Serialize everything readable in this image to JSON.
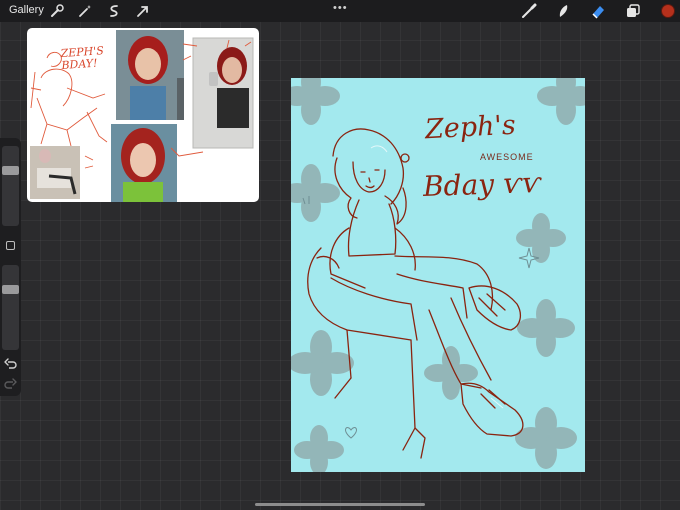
{
  "topbar": {
    "gallery_label": "Gallery",
    "more_label": "•••",
    "left_tools": [
      "wrench-icon",
      "magic-wand-icon",
      "selection-icon",
      "transform-arrow-icon"
    ],
    "right_tools": [
      "brush-icon",
      "smudge-icon",
      "eraser-icon",
      "layers-icon"
    ],
    "active_tool": "eraser-icon",
    "active_tool_color": "#3b8df0",
    "current_color": "#b5301c"
  },
  "sidebar": {
    "brush_size": 0.7,
    "opacity": 0.7,
    "icons": [
      "modify-square-icon",
      "undo-icon",
      "redo-icon"
    ]
  },
  "reference": {
    "title_text": "ZEPH'S\nBDAY!"
  },
  "artwork": {
    "background_color": "#a3e9ee",
    "line_color": "#8a2410",
    "title_line1": "Zeph's",
    "title_line2": "AWESOME",
    "title_line3": "Bday ѵѵ"
  }
}
